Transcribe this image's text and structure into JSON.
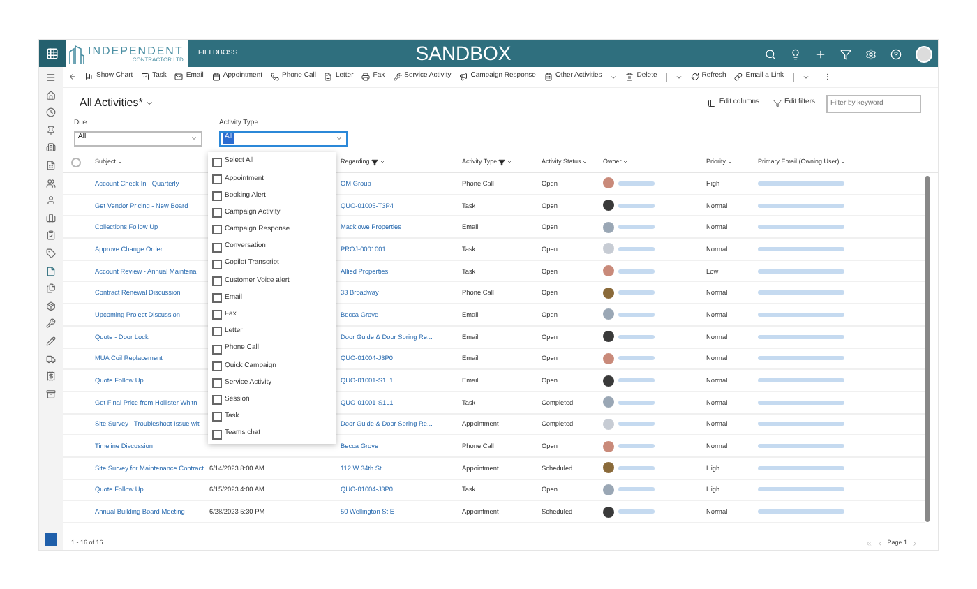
{
  "header": {
    "logo_line1": "INDEPENDENT",
    "logo_line2": "CONTRACTOR LTD",
    "app_name": "FIELDBOSS",
    "environment": "SANDBOX"
  },
  "commands": [
    {
      "label": "Show Chart",
      "kind": "plain"
    },
    {
      "label": "Task",
      "kind": "plain"
    },
    {
      "label": "Email",
      "kind": "plain"
    },
    {
      "label": "Appointment",
      "kind": "plain"
    },
    {
      "label": "Phone Call",
      "kind": "plain"
    },
    {
      "label": "Letter",
      "kind": "plain"
    },
    {
      "label": "Fax",
      "kind": "plain"
    },
    {
      "label": "Service Activity",
      "kind": "plain"
    },
    {
      "label": "Campaign Response",
      "kind": "plain"
    },
    {
      "label": "Other Activities",
      "kind": "menu"
    },
    {
      "label": "Delete",
      "kind": "split"
    },
    {
      "label": "Refresh",
      "kind": "plain"
    },
    {
      "label": "Email a Link",
      "kind": "split"
    }
  ],
  "view": {
    "title": "All Activities*",
    "edit_columns": "Edit columns",
    "edit_filters": "Edit filters",
    "search_placeholder": "Filter by keyword"
  },
  "filters": [
    {
      "label": "Due",
      "value": "All",
      "open": false
    },
    {
      "label": "Activity Type",
      "value": "All",
      "open": true
    }
  ],
  "dropdown_options": [
    {
      "label": "Select All",
      "checked": false
    },
    {
      "label": "Appointment",
      "checked": false
    },
    {
      "label": "Booking Alert",
      "checked": false
    },
    {
      "label": "Campaign Activity",
      "checked": false
    },
    {
      "label": "Campaign Response",
      "checked": false
    },
    {
      "label": "Conversation",
      "checked": false
    },
    {
      "label": "Copilot Transcript",
      "checked": false
    },
    {
      "label": "Customer Voice alert",
      "checked": false
    },
    {
      "label": "Email",
      "checked": false
    },
    {
      "label": "Fax",
      "checked": false
    },
    {
      "label": "Letter",
      "checked": false
    },
    {
      "label": "Phone Call",
      "checked": false
    },
    {
      "label": "Quick Campaign",
      "checked": false
    },
    {
      "label": "Service Activity",
      "checked": false
    },
    {
      "label": "Session",
      "checked": false
    },
    {
      "label": "Task",
      "checked": false
    },
    {
      "label": "Teams chat",
      "checked": false
    }
  ],
  "table": {
    "select_all_checked": false,
    "columns": [
      {
        "label": "Subject",
        "filtered": false
      },
      {
        "label": "Regarding",
        "filtered": true
      },
      {
        "label": "Activity Type",
        "filtered": true
      },
      {
        "label": "Activity Status",
        "filtered": false
      },
      {
        "label": "Owner",
        "filtered": false
      },
      {
        "label": "Priority",
        "filtered": false
      },
      {
        "label": "Primary Email (Owning User)",
        "filtered": false
      }
    ],
    "rows": [
      {
        "subject": "Account Check In - Quarterly",
        "regarding": "OM Group",
        "type": "Phone Call",
        "status": "Open",
        "priority": "High"
      },
      {
        "subject": "Get Vendor Pricing - New Board",
        "regarding": "QUO-01005-T3P4",
        "type": "Task",
        "status": "Open",
        "priority": "Normal"
      },
      {
        "subject": "Collections Follow Up",
        "regarding": "Macklowe Properties",
        "type": "Email",
        "status": "Open",
        "priority": "Normal"
      },
      {
        "subject": "Approve Change Order",
        "regarding": "PROJ-0001001",
        "type": "Task",
        "status": "Open",
        "priority": "Normal"
      },
      {
        "subject": "Account Review - Annual Maintena",
        "regarding": "Allied Properties",
        "type": "Task",
        "status": "Open",
        "priority": "Low"
      },
      {
        "subject": "Contract Renewal Discussion",
        "regarding": "33 Broadway",
        "type": "Phone Call",
        "status": "Open",
        "priority": "Normal"
      },
      {
        "subject": "Upcoming Project Discussion",
        "regarding": "Becca Grove",
        "type": "Email",
        "status": "Open",
        "priority": "Normal"
      },
      {
        "subject": "Quote - Door Lock",
        "regarding": "Door Guide & Door Spring Re...",
        "type": "Email",
        "status": "Open",
        "priority": "Normal"
      },
      {
        "subject": "MUA Coil Replacement",
        "regarding": "QUO-01004-J3P0",
        "type": "Email",
        "status": "Open",
        "priority": "Normal"
      },
      {
        "subject": "Quote Follow Up",
        "regarding": "QUO-01001-S1L1",
        "type": "Email",
        "status": "Open",
        "priority": "Normal"
      },
      {
        "subject": "Get Final Price from Hollister Whitn",
        "regarding": "QUO-01001-S1L1",
        "type": "Task",
        "status": "Completed",
        "priority": "Normal"
      },
      {
        "subject": "Site Survey - Troubleshoot Issue wit",
        "regarding": "Door Guide & Door Spring Re...",
        "type": "Appointment",
        "status": "Completed",
        "priority": "Normal"
      },
      {
        "subject": "Timeline Discussion",
        "regarding": "Becca Grove",
        "type": "Phone Call",
        "status": "Open",
        "priority": "Normal"
      },
      {
        "subject": "Site Survey for Maintenance Contract",
        "due": "6/14/2023 8:00 AM",
        "regarding": "112 W 34th St",
        "type": "Appointment",
        "status": "Scheduled",
        "priority": "High"
      },
      {
        "subject": "Quote Follow Up",
        "due": "6/15/2023 4:00 AM",
        "regarding": "QUO-01004-J3P0",
        "type": "Task",
        "status": "Open",
        "priority": "High"
      },
      {
        "subject": "Annual Building Board Meeting",
        "due": "6/28/2023 5:30 PM",
        "regarding": "50 Wellington St E",
        "type": "Appointment",
        "status": "Scheduled",
        "priority": "Normal"
      }
    ]
  },
  "footer": {
    "count": "1 - 16 of 16",
    "page": "Page 1"
  }
}
